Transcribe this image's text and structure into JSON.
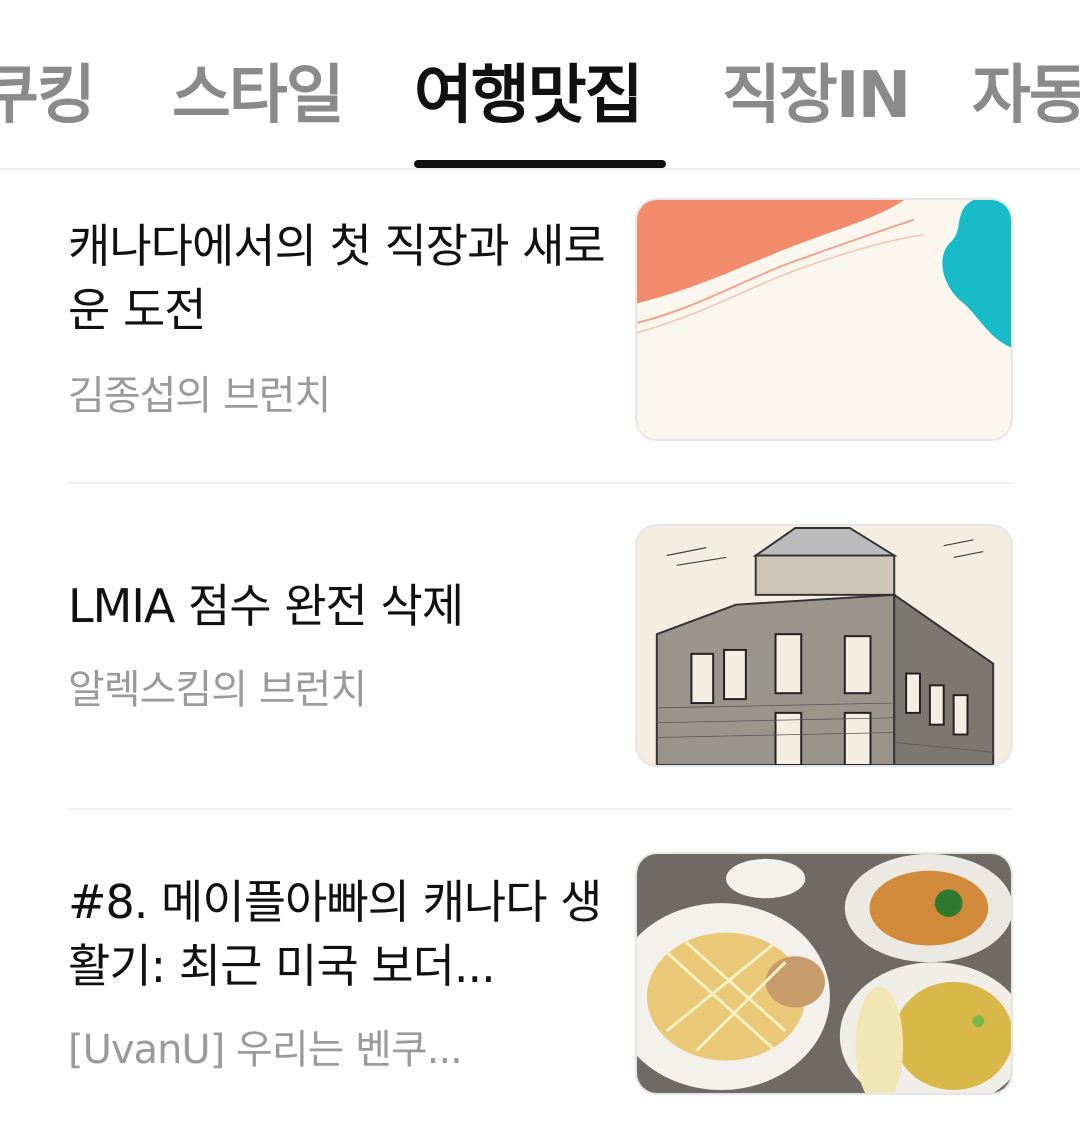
{
  "tabs": [
    {
      "label": "쿠킹",
      "active": false
    },
    {
      "label": "스타일",
      "active": false
    },
    {
      "label": "여행맛집",
      "active": true
    },
    {
      "label": "직장IN",
      "active": false
    },
    {
      "label": "자동차",
      "active": false
    }
  ],
  "articles": [
    {
      "title": "캐나다에서의 첫 직장과 새로운 도전",
      "source": "김종섭의 브런치",
      "thumbnail": "abstract-orange-teal-illustration"
    },
    {
      "title": "LMIA 점수 완전 삭제",
      "source": "알렉스킴의 브런치",
      "thumbnail": "brick-building-sketch"
    },
    {
      "title": "#8. 메이플아빠의 캐나다 생활기: 최근 미국 보더...",
      "source": "[UvanU] 우리는 벤쿠...",
      "thumbnail": "thai-food-plates-photo"
    }
  ],
  "colors": {
    "active_tab": "#111111",
    "inactive_tab": "#8a8a8a",
    "source_text": "#9a9a9a",
    "divider": "#efefef"
  }
}
